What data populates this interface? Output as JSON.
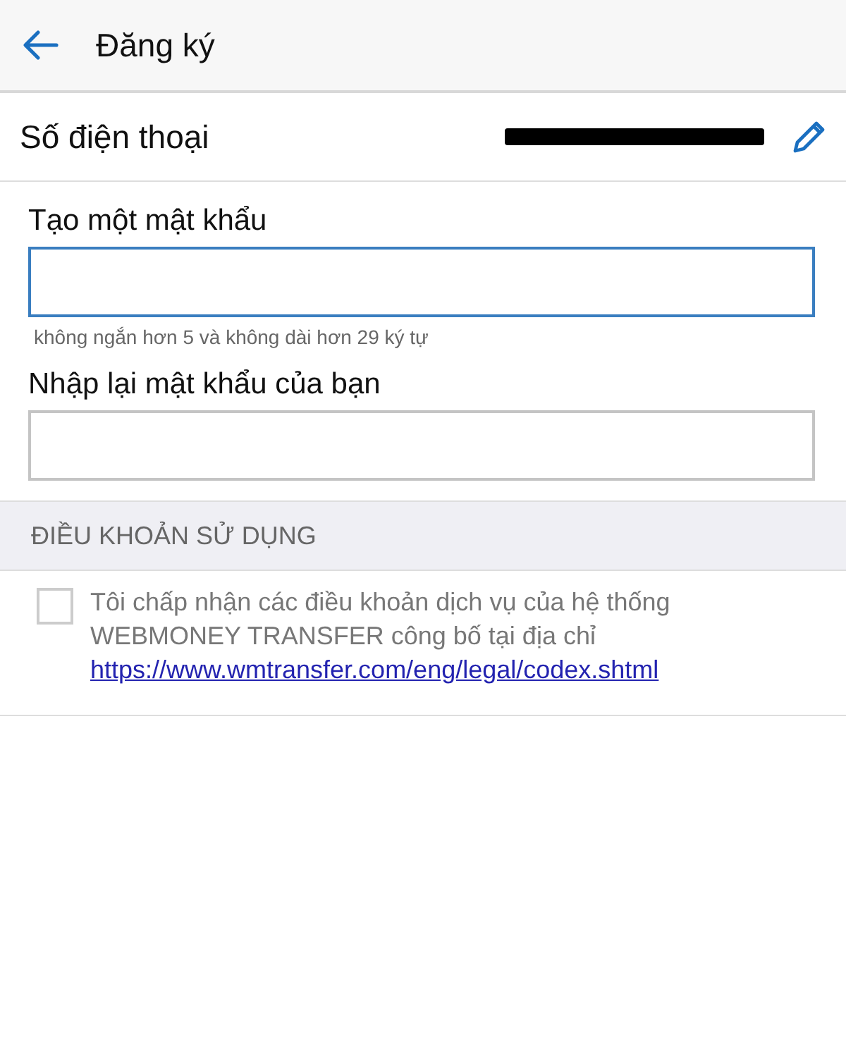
{
  "header": {
    "title": "Đăng ký"
  },
  "phone": {
    "label": "Số điện thoại",
    "redacted": true
  },
  "fields": [
    {
      "label": "Tạo một mật khẩu",
      "focused": true,
      "hint": "không ngắn hơn 5 và không dài hơn 29 ký tự"
    },
    {
      "label": "Nhập lại mật khẩu của bạn",
      "focused": false
    }
  ],
  "terms": {
    "heading": "ĐIỀU KHOẢN SỬ DỤNG",
    "checked": false,
    "text": "Tôi chấp nhận các điều khoản dịch vụ của hệ thống WEBMONEY TRANSFER công bố tại địa chỉ",
    "link": "https://www.wmtransfer.com/eng/legal/codex.shtml"
  }
}
